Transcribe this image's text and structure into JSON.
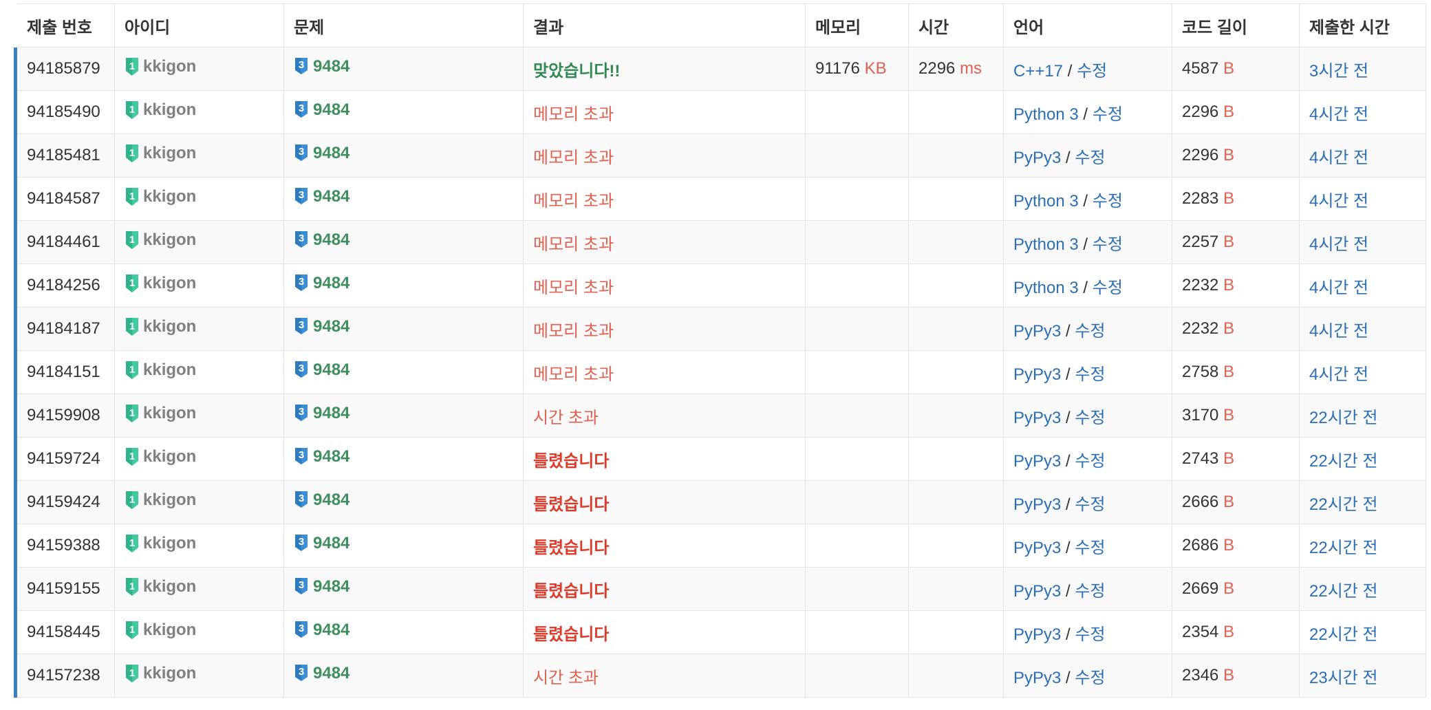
{
  "colors": {
    "accent_bar": "#3a7fc1",
    "user_gray": "#808080",
    "problem_green": "#3f8f5e",
    "accepted": "#2f8a4f",
    "error_red": "#e0614f",
    "wrong_red": "#dd3b2a",
    "link_blue": "#2a6fb5"
  },
  "headers": [
    "제출 번호",
    "아이디",
    "문제",
    "결과",
    "메모리",
    "시간",
    "언어",
    "코드 길이",
    "제출한 시간"
  ],
  "edit_label": "수정",
  "separator": "/",
  "icons": {
    "user_tier": "level-1-shield-icon",
    "problem_tier": "level-3-badge-icon"
  },
  "user_tier_number": "1",
  "problem_tier_number": "3",
  "rows": [
    {
      "id": "94185879",
      "user": "kkigon",
      "problem": "9484",
      "result": "맞았습니다!!",
      "result_type": "ac",
      "memory": "91176",
      "memory_unit": "KB",
      "time": "2296",
      "time_unit": "ms",
      "lang": "C++17",
      "length": "4587",
      "length_unit": "B",
      "submitted": "3시간 전"
    },
    {
      "id": "94185490",
      "user": "kkigon",
      "problem": "9484",
      "result": "메모리 초과",
      "result_type": "mle",
      "memory": "",
      "memory_unit": "",
      "time": "",
      "time_unit": "",
      "lang": "Python 3",
      "length": "2296",
      "length_unit": "B",
      "submitted": "4시간 전"
    },
    {
      "id": "94185481",
      "user": "kkigon",
      "problem": "9484",
      "result": "메모리 초과",
      "result_type": "mle",
      "memory": "",
      "memory_unit": "",
      "time": "",
      "time_unit": "",
      "lang": "PyPy3",
      "length": "2296",
      "length_unit": "B",
      "submitted": "4시간 전"
    },
    {
      "id": "94184587",
      "user": "kkigon",
      "problem": "9484",
      "result": "메모리 초과",
      "result_type": "mle",
      "memory": "",
      "memory_unit": "",
      "time": "",
      "time_unit": "",
      "lang": "Python 3",
      "length": "2283",
      "length_unit": "B",
      "submitted": "4시간 전"
    },
    {
      "id": "94184461",
      "user": "kkigon",
      "problem": "9484",
      "result": "메모리 초과",
      "result_type": "mle",
      "memory": "",
      "memory_unit": "",
      "time": "",
      "time_unit": "",
      "lang": "Python 3",
      "length": "2257",
      "length_unit": "B",
      "submitted": "4시간 전"
    },
    {
      "id": "94184256",
      "user": "kkigon",
      "problem": "9484",
      "result": "메모리 초과",
      "result_type": "mle",
      "memory": "",
      "memory_unit": "",
      "time": "",
      "time_unit": "",
      "lang": "Python 3",
      "length": "2232",
      "length_unit": "B",
      "submitted": "4시간 전"
    },
    {
      "id": "94184187",
      "user": "kkigon",
      "problem": "9484",
      "result": "메모리 초과",
      "result_type": "mle",
      "memory": "",
      "memory_unit": "",
      "time": "",
      "time_unit": "",
      "lang": "PyPy3",
      "length": "2232",
      "length_unit": "B",
      "submitted": "4시간 전"
    },
    {
      "id": "94184151",
      "user": "kkigon",
      "problem": "9484",
      "result": "메모리 초과",
      "result_type": "mle",
      "memory": "",
      "memory_unit": "",
      "time": "",
      "time_unit": "",
      "lang": "PyPy3",
      "length": "2758",
      "length_unit": "B",
      "submitted": "4시간 전"
    },
    {
      "id": "94159908",
      "user": "kkigon",
      "problem": "9484",
      "result": "시간 초과",
      "result_type": "tle",
      "memory": "",
      "memory_unit": "",
      "time": "",
      "time_unit": "",
      "lang": "PyPy3",
      "length": "3170",
      "length_unit": "B",
      "submitted": "22시간 전"
    },
    {
      "id": "94159724",
      "user": "kkigon",
      "problem": "9484",
      "result": "틀렸습니다",
      "result_type": "wa",
      "memory": "",
      "memory_unit": "",
      "time": "",
      "time_unit": "",
      "lang": "PyPy3",
      "length": "2743",
      "length_unit": "B",
      "submitted": "22시간 전"
    },
    {
      "id": "94159424",
      "user": "kkigon",
      "problem": "9484",
      "result": "틀렸습니다",
      "result_type": "wa",
      "memory": "",
      "memory_unit": "",
      "time": "",
      "time_unit": "",
      "lang": "PyPy3",
      "length": "2666",
      "length_unit": "B",
      "submitted": "22시간 전"
    },
    {
      "id": "94159388",
      "user": "kkigon",
      "problem": "9484",
      "result": "틀렸습니다",
      "result_type": "wa",
      "memory": "",
      "memory_unit": "",
      "time": "",
      "time_unit": "",
      "lang": "PyPy3",
      "length": "2686",
      "length_unit": "B",
      "submitted": "22시간 전"
    },
    {
      "id": "94159155",
      "user": "kkigon",
      "problem": "9484",
      "result": "틀렸습니다",
      "result_type": "wa",
      "memory": "",
      "memory_unit": "",
      "time": "",
      "time_unit": "",
      "lang": "PyPy3",
      "length": "2669",
      "length_unit": "B",
      "submitted": "22시간 전"
    },
    {
      "id": "94158445",
      "user": "kkigon",
      "problem": "9484",
      "result": "틀렸습니다",
      "result_type": "wa",
      "memory": "",
      "memory_unit": "",
      "time": "",
      "time_unit": "",
      "lang": "PyPy3",
      "length": "2354",
      "length_unit": "B",
      "submitted": "22시간 전"
    },
    {
      "id": "94157238",
      "user": "kkigon",
      "problem": "9484",
      "result": "시간 초과",
      "result_type": "tle",
      "memory": "",
      "memory_unit": "",
      "time": "",
      "time_unit": "",
      "lang": "PyPy3",
      "length": "2346",
      "length_unit": "B",
      "submitted": "23시간 전"
    }
  ]
}
